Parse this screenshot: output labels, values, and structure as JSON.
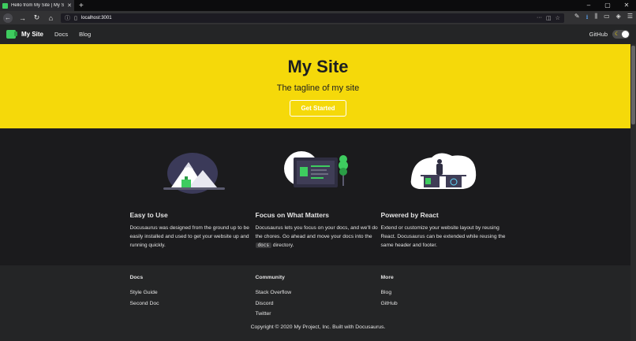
{
  "browser": {
    "tab_title": "Hello from My Site | My Site",
    "url": "localhost:3001",
    "window_minimize": "–",
    "window_maximize": "▢",
    "window_close": "✕"
  },
  "site_nav": {
    "brand": "My Site",
    "links": [
      "Docs",
      "Blog"
    ],
    "github": "GitHub"
  },
  "hero": {
    "title": "My Site",
    "tagline": "The tagline of my site",
    "cta": "Get Started"
  },
  "features": [
    {
      "title": "Easy to Use",
      "desc": "Docusaurus was designed from the ground up to be easily installed and used to get your website up and running quickly."
    },
    {
      "title": "Focus on What Matters",
      "desc_before": "Docusaurus lets you focus on your docs, and we'll do the chores. Go ahead and move your docs into the ",
      "code": "docs",
      "desc_after": " directory."
    },
    {
      "title": "Powered by React",
      "desc": "Extend or customize your website layout by reusing React. Docusaurus can be extended while reusing the same header and footer."
    }
  ],
  "footer": {
    "columns": [
      {
        "title": "Docs",
        "links": [
          "Style Guide",
          "Second Doc"
        ]
      },
      {
        "title": "Community",
        "links": [
          "Stack Overflow",
          "Discord",
          "Twitter"
        ]
      },
      {
        "title": "More",
        "links": [
          "Blog",
          "GitHub"
        ]
      }
    ],
    "copyright": "Copyright © 2020 My Project, Inc. Built with Docusaurus."
  },
  "colors": {
    "hero_bg": "#f5d90a",
    "page_bg": "#1b1b1d",
    "footer_bg": "#242526",
    "accent_green": "#3ecc5f"
  }
}
